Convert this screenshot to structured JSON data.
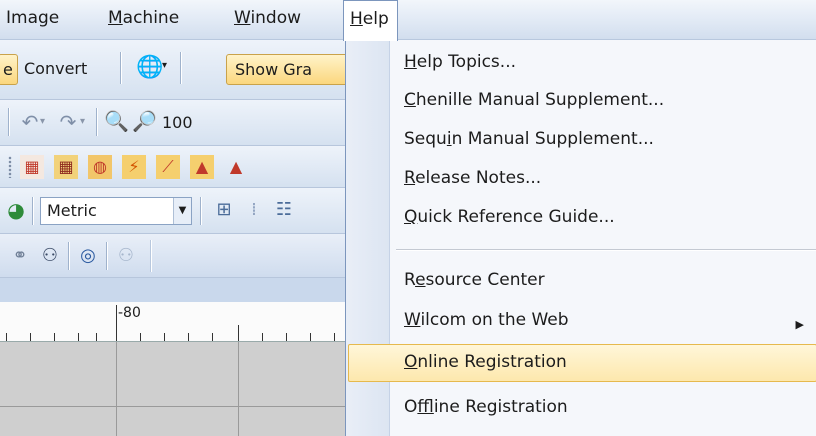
{
  "menubar": {
    "items": [
      "Image",
      "Machine",
      "Window",
      "Help"
    ],
    "mnemonic_index": [
      null,
      0,
      0,
      0
    ]
  },
  "toolbar": {
    "row1": {
      "partial_button": "e",
      "convert": "Convert",
      "globe_icon": "globe-dropdown-icon",
      "show_graphics": "Show Gra"
    },
    "row2": {
      "zoom_value": "100"
    },
    "row4": {
      "units_value": "Metric"
    }
  },
  "ruler": {
    "label": "-80"
  },
  "help_menu": {
    "items": [
      {
        "pre": "",
        "key": "H",
        "post": "elp Topics..."
      },
      {
        "pre": "",
        "key": "C",
        "post": "henille Manual Supplement..."
      },
      {
        "pre": "Sequ",
        "key": "i",
        "post": "n Manual Supplement..."
      },
      {
        "pre": "",
        "key": "R",
        "post": "elease Notes..."
      },
      {
        "pre": "",
        "key": "Q",
        "post": "uick Reference Guide..."
      },
      {
        "pre": "R",
        "key": "e",
        "post": "source Center"
      },
      {
        "pre": "",
        "key": "W",
        "post": "ilcom on the Web"
      },
      {
        "pre": "",
        "key": "O",
        "post": "nline Registration"
      },
      {
        "pre": "O",
        "key": "f",
        "post": "fline Registration"
      }
    ],
    "highlighted_index": 7,
    "submenu_index": 6
  },
  "colors": {
    "highlight": "#fde8ad",
    "menubar": "#dfe8f4",
    "button": "#fbd77e"
  }
}
